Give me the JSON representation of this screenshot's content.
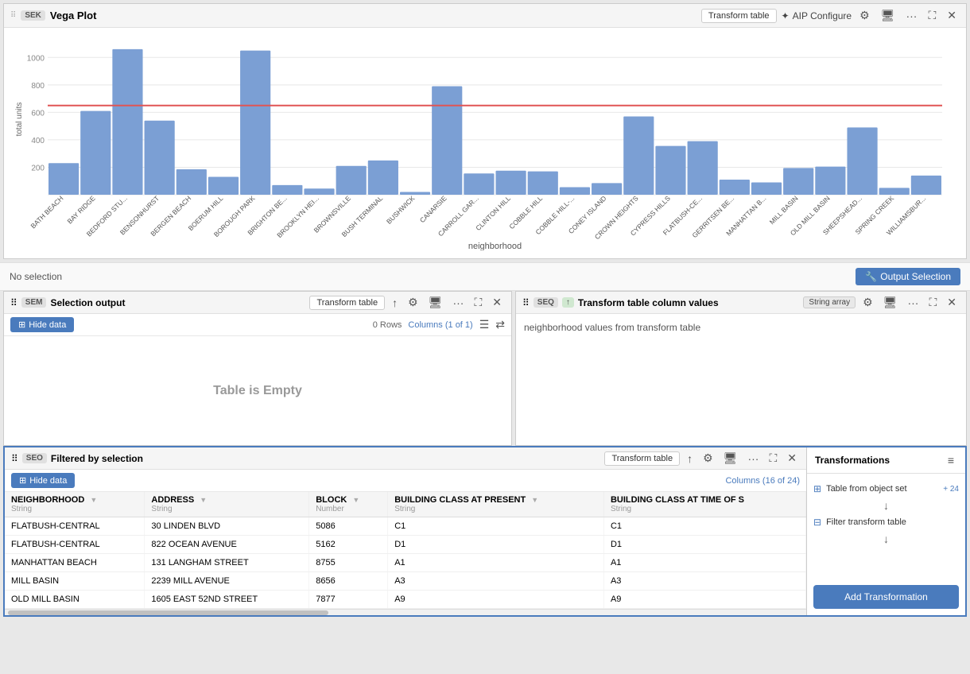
{
  "vegaPanel": {
    "dragHandle": "⠿",
    "tag": "SEK",
    "title": "Vega Plot",
    "transformBtn": "Transform table",
    "aipBtn": "AIP Configure",
    "chart": {
      "yAxisLabel": "total units",
      "xAxisLabel": "neighborhood",
      "referenceLineY": 650,
      "bars": [
        {
          "label": "BATH BEACH",
          "value": 230
        },
        {
          "label": "BAY RIDGE",
          "value": 610
        },
        {
          "label": "BEDFORD STU...",
          "value": 1060
        },
        {
          "label": "BENSONHURST",
          "value": 540
        },
        {
          "label": "BERGEN BEACH",
          "value": 185
        },
        {
          "label": "BOERUM HILL",
          "value": 130
        },
        {
          "label": "BOROUGH PARK",
          "value": 1050
        },
        {
          "label": "BRIGHTON BE...",
          "value": 70
        },
        {
          "label": "BROOKLYN HEI...",
          "value": 45
        },
        {
          "label": "BROWNSVILLE",
          "value": 210
        },
        {
          "label": "BUSH TERMINAL",
          "value": 250
        },
        {
          "label": "BUSHWICK",
          "value": 20
        },
        {
          "label": "CANARSIE",
          "value": 790
        },
        {
          "label": "CARROLL GAR...",
          "value": 155
        },
        {
          "label": "CLINTON HILL",
          "value": 175
        },
        {
          "label": "COBBLE HILL",
          "value": 170
        },
        {
          "label": "COBBLE HILL-...",
          "value": 55
        },
        {
          "label": "CONEY ISLAND",
          "value": 85
        },
        {
          "label": "CROWN HEIGHTS",
          "value": 570
        },
        {
          "label": "CYPRESS HILLS",
          "value": 355
        },
        {
          "label": "FLATBUSH-CE...",
          "value": 390
        },
        {
          "label": "GERRITSEN BE...",
          "value": 110
        },
        {
          "label": "MANHATTAN B...",
          "value": 90
        },
        {
          "label": "MILL BASIN",
          "value": 195
        },
        {
          "label": "OLD MILL BASIN",
          "value": 205
        },
        {
          "label": "SHEEPSHEAD...",
          "value": 490
        },
        {
          "label": "SPRING CREEK",
          "value": 50
        },
        {
          "label": "WILLIAMSBUR...",
          "value": 140
        }
      ]
    }
  },
  "selectionBar": {
    "text": "No selection",
    "btnLabel": "Output Selection",
    "btnIcon": "🔧"
  },
  "selectionOutput": {
    "tag": "SEM",
    "title": "Selection output",
    "transformBtn": "Transform table",
    "rowCount": "0 Rows",
    "colCount": "Columns (1 of 1)",
    "emptyText": "Table is Empty"
  },
  "transformColumn": {
    "tag": "SEQ",
    "tagIcon": "[↑]",
    "title": "Transform table column values",
    "badge": "String array",
    "content": "neighborhood values from transform table"
  },
  "filteredPanel": {
    "tag": "SEO",
    "title": "Filtered by selection",
    "transformBtn": "Transform table",
    "colCount": "Columns (16 of 24)",
    "columns": [
      {
        "name": "NEIGHBORHOOD",
        "type": "String"
      },
      {
        "name": "ADDRESS",
        "type": "String"
      },
      {
        "name": "BLOCK",
        "type": "Number"
      },
      {
        "name": "BUILDING CLASS AT PRESENT",
        "type": "String"
      },
      {
        "name": "BUILDING CLASS AT TIME OF S",
        "type": "String"
      }
    ],
    "rows": [
      {
        "neighborhood": "FLATBUSH-CENTRAL",
        "address": "30 LINDEN BLVD",
        "block": "5086",
        "buildingClass": "C1",
        "buildingClassTime": "C1"
      },
      {
        "neighborhood": "FLATBUSH-CENTRAL",
        "address": "822 OCEAN AVENUE",
        "block": "5162",
        "buildingClass": "D1",
        "buildingClassTime": "D1"
      },
      {
        "neighborhood": "MANHATTAN BEACH",
        "address": "131 LANGHAM STREET",
        "block": "8755",
        "buildingClass": "A1",
        "buildingClassTime": "A1"
      },
      {
        "neighborhood": "MILL BASIN",
        "address": "2239 MILL AVENUE",
        "block": "8656",
        "buildingClass": "A3",
        "buildingClassTime": "A3"
      },
      {
        "neighborhood": "OLD MILL BASIN",
        "address": "1605 EAST 52ND STREET",
        "block": "7877",
        "buildingClass": "A9",
        "buildingClassTime": "A9"
      }
    ]
  },
  "transformations": {
    "title": "Transformations",
    "items": [
      {
        "icon": "⊞",
        "label": "Table from object set",
        "count": "+ 24"
      },
      {
        "icon": "⊟",
        "label": "Filter transform table",
        "count": ""
      }
    ],
    "addBtn": "Add Transformation"
  },
  "icons": {
    "gear": "⚙",
    "monitor": "🖥",
    "more": "···",
    "expand": "⛶",
    "close": "✕",
    "upload": "↑",
    "columns": "☰",
    "swap": "⇄",
    "menu": "≡"
  }
}
